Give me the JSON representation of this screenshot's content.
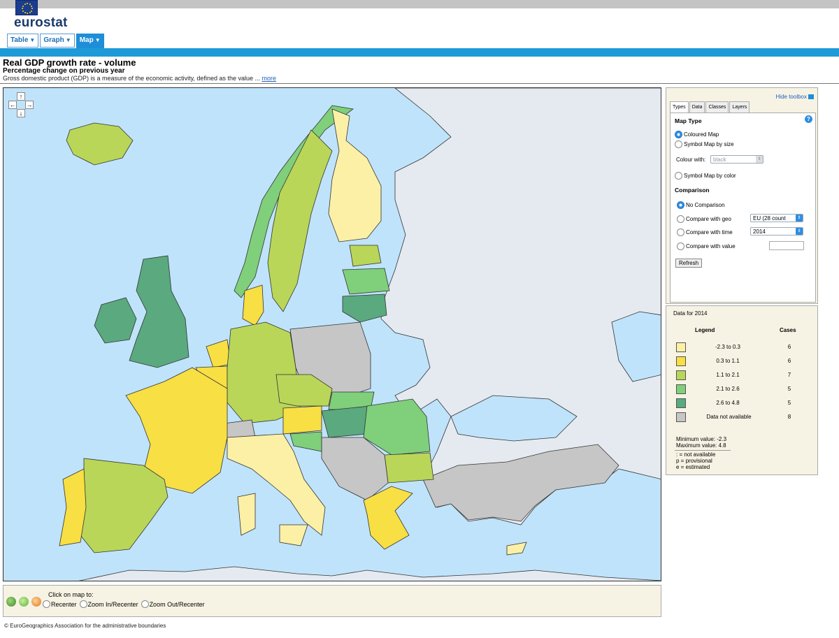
{
  "brand": "eurostat",
  "tabs": [
    {
      "label": "Table",
      "active": false
    },
    {
      "label": "Graph",
      "active": false
    },
    {
      "label": "Map",
      "active": true
    }
  ],
  "header": {
    "title": "Real GDP growth rate - volume",
    "subtitle": "Percentage change on previous year",
    "description": "Gross domestic product (GDP) is a measure of the economic activity, defined as the value ...",
    "more_link": "more"
  },
  "map": {
    "pan": {
      "up": "↑",
      "down": "↓",
      "left": "←",
      "right": "→"
    },
    "colors": {
      "sea": "#bfe3fa",
      "non_eu_land": "#e5eaf0",
      "border": "#333333",
      "class_1": "#fcf0a6",
      "class_2": "#f7df44",
      "class_3": "#b9d659",
      "class_4": "#7fcf7b",
      "class_5": "#5aa97f",
      "not_available": "#c6c6c6"
    }
  },
  "bottombar": {
    "instruction": "Click on map to:",
    "options": [
      {
        "label": "Recenter",
        "selected": false
      },
      {
        "label": "Zoom In/Recenter",
        "selected": false
      },
      {
        "label": "Zoom Out/Recenter",
        "selected": false
      }
    ]
  },
  "copyright": "© EuroGeographics Association for the administrative boundaries",
  "toolbox": {
    "hide_label": "Hide toolbox",
    "tabs": [
      "Types",
      "Data",
      "Classes",
      "Layers"
    ],
    "active_tab": "Types",
    "map_type_heading": "Map Type",
    "map_types": [
      {
        "label": "Coloured Map",
        "selected": true
      },
      {
        "label": "Symbol Map by size",
        "selected": false
      }
    ],
    "colour_with_label": "Colour with:",
    "colour_with_value": "black",
    "symbol_by_color": "Symbol Map by color",
    "comparison_heading": "Comparison",
    "comparisons": [
      {
        "label": "No Comparison",
        "selected": true
      },
      {
        "label": "Compare with geo",
        "selected": false,
        "select": "EU (28 count"
      },
      {
        "label": "Compare with time",
        "selected": false,
        "select": "2014"
      },
      {
        "label": "Compare with value",
        "selected": false
      }
    ],
    "refresh_label": "Refresh"
  },
  "legend": {
    "title": "Data for 2014",
    "col_legend": "Legend",
    "col_cases": "Cases",
    "classes": [
      {
        "range": "-2.3  to  0.3",
        "cases": "6",
        "color": "#fcf0a6"
      },
      {
        "range": "0.3  to  1.1",
        "cases": "6",
        "color": "#f7df44"
      },
      {
        "range": "1.1  to  2.1",
        "cases": "7",
        "color": "#b9d659"
      },
      {
        "range": "2.1  to  2.6",
        "cases": "5",
        "color": "#7fcf7b"
      },
      {
        "range": "2.6  to  4.8",
        "cases": "5",
        "color": "#5aa97f"
      },
      {
        "range": "Data not available",
        "cases": "8",
        "color": "#c6c6c6"
      }
    ],
    "min_value": "Minimum value: -2.3",
    "max_value": "Maximum value: 4.8",
    "flags": [
      ": = not available",
      "p = provisional",
      "e = estimated"
    ]
  }
}
